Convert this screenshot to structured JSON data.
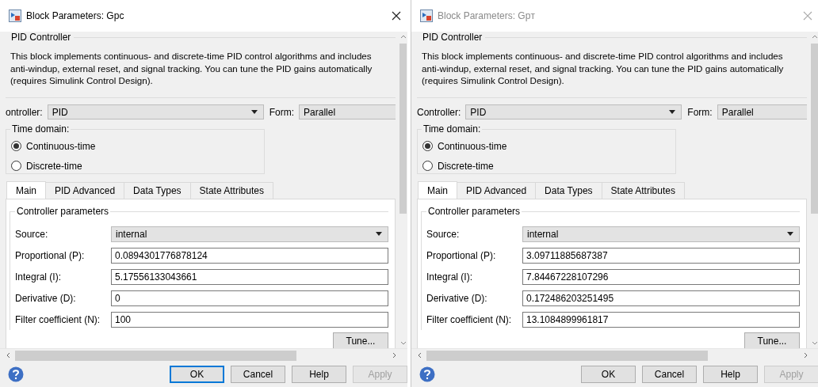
{
  "dialogs": [
    {
      "title": "Block Parameters: Gpc",
      "active": true,
      "section_title": "PID Controller",
      "description": [
        "This block implements continuous- and discrete-time PID control algorithms and includes",
        "anti-windup, external reset, and signal tracking. You can tune the PID gains automatically",
        "(requires Simulink Control Design)."
      ],
      "controller": {
        "label": "ontroller:",
        "value": "PID"
      },
      "form": {
        "label": "Form:",
        "value": "Parallel"
      },
      "time_domain": {
        "title": "Time domain:",
        "options": [
          {
            "label": "Continuous-time",
            "selected": true
          },
          {
            "label": "Discrete-time",
            "selected": false
          }
        ]
      },
      "tabs": [
        {
          "label": "Main",
          "selected": true
        },
        {
          "label": "PID Advanced",
          "selected": false
        },
        {
          "label": "Data Types",
          "selected": false
        },
        {
          "label": "State Attributes",
          "selected": false
        }
      ],
      "params_title": "Controller parameters",
      "source": {
        "label": "Source:",
        "value": "internal"
      },
      "params": [
        {
          "label": "Proportional (P):",
          "value": "0.0894301776878124"
        },
        {
          "label": "Integral (I):",
          "value": "5.17556133043661"
        },
        {
          "label": "Derivative (D):",
          "value": "0"
        },
        {
          "label": "Filter coefficient (N):",
          "value": "100"
        }
      ],
      "tune_button": "Tune...",
      "buttons": [
        {
          "label": "OK",
          "focused": true,
          "disabled": false
        },
        {
          "label": "Cancel",
          "focused": false,
          "disabled": false
        },
        {
          "label": "Help",
          "focused": false,
          "disabled": false
        },
        {
          "label": "Apply",
          "focused": false,
          "disabled": true
        }
      ]
    },
    {
      "title": "Block Parameters: Gpт",
      "active": false,
      "section_title": "PID Controller",
      "description": [
        "This block implements continuous- and discrete-time PID control algorithms and includes",
        "anti-windup, external reset, and signal tracking. You can tune the PID gains automatically",
        "(requires Simulink Control Design)."
      ],
      "controller": {
        "label": "Controller:",
        "value": "PID"
      },
      "form": {
        "label": "Form:",
        "value": "Parallel"
      },
      "time_domain": {
        "title": "Time domain:",
        "options": [
          {
            "label": "Continuous-time",
            "selected": true
          },
          {
            "label": "Discrete-time",
            "selected": false
          }
        ]
      },
      "tabs": [
        {
          "label": "Main",
          "selected": true
        },
        {
          "label": "PID Advanced",
          "selected": false
        },
        {
          "label": "Data Types",
          "selected": false
        },
        {
          "label": "State Attributes",
          "selected": false
        }
      ],
      "params_title": "Controller parameters",
      "source": {
        "label": "Source:",
        "value": "internal"
      },
      "params": [
        {
          "label": "Proportional (P):",
          "value": "3.09711885687387"
        },
        {
          "label": "Integral (I):",
          "value": "7.84467228107296"
        },
        {
          "label": "Derivative (D):",
          "value": "0.172486203251495"
        },
        {
          "label": "Filter coefficient (N):",
          "value": "13.1084899961817"
        }
      ],
      "tune_button": "Tune...",
      "buttons": [
        {
          "label": "OK",
          "focused": false,
          "disabled": false
        },
        {
          "label": "Cancel",
          "focused": false,
          "disabled": false
        },
        {
          "label": "Help",
          "focused": false,
          "disabled": false
        },
        {
          "label": "Apply",
          "focused": false,
          "disabled": true
        }
      ]
    }
  ]
}
